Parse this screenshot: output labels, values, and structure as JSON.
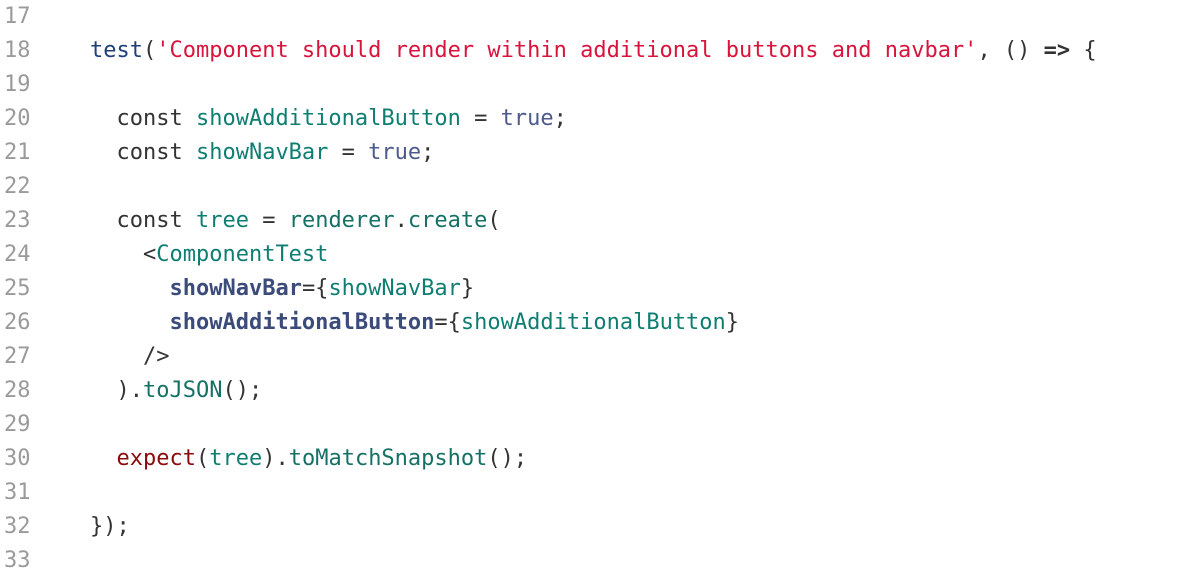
{
  "lines": [
    {
      "num": "17",
      "tokens": []
    },
    {
      "num": "18",
      "tokens": [
        {
          "t": "test",
          "c": "fn"
        },
        {
          "t": "(",
          "c": "plain"
        },
        {
          "t": "'Component should render within additional buttons and navbar'",
          "c": "str"
        },
        {
          "t": ", () ",
          "c": "plain"
        },
        {
          "t": "=>",
          "c": "bold"
        },
        {
          "t": " {",
          "c": "plain"
        }
      ]
    },
    {
      "num": "19",
      "tokens": []
    },
    {
      "num": "20",
      "tokens": [
        {
          "t": "  const ",
          "c": "plain"
        },
        {
          "t": "showAdditionalButton",
          "c": "var"
        },
        {
          "t": " = ",
          "c": "plain"
        },
        {
          "t": "true",
          "c": "bool"
        },
        {
          "t": ";",
          "c": "plain"
        }
      ]
    },
    {
      "num": "21",
      "tokens": [
        {
          "t": "  const ",
          "c": "plain"
        },
        {
          "t": "showNavBar",
          "c": "var"
        },
        {
          "t": " = ",
          "c": "plain"
        },
        {
          "t": "true",
          "c": "bool"
        },
        {
          "t": ";",
          "c": "plain"
        }
      ]
    },
    {
      "num": "22",
      "tokens": []
    },
    {
      "num": "23",
      "tokens": [
        {
          "t": "  const ",
          "c": "plain"
        },
        {
          "t": "tree",
          "c": "var"
        },
        {
          "t": " = ",
          "c": "plain"
        },
        {
          "t": "renderer",
          "c": "call"
        },
        {
          "t": ".",
          "c": "plain"
        },
        {
          "t": "create",
          "c": "call"
        },
        {
          "t": "(",
          "c": "plain"
        }
      ]
    },
    {
      "num": "24",
      "tokens": [
        {
          "t": "    <",
          "c": "plain"
        },
        {
          "t": "ComponentTest",
          "c": "var"
        }
      ]
    },
    {
      "num": "25",
      "tokens": [
        {
          "t": "      ",
          "c": "plain"
        },
        {
          "t": "showNavBar",
          "c": "attr"
        },
        {
          "t": "={",
          "c": "plain"
        },
        {
          "t": "showNavBar",
          "c": "var"
        },
        {
          "t": "}",
          "c": "plain"
        }
      ]
    },
    {
      "num": "26",
      "tokens": [
        {
          "t": "      ",
          "c": "plain"
        },
        {
          "t": "showAdditionalButton",
          "c": "attr"
        },
        {
          "t": "={",
          "c": "plain"
        },
        {
          "t": "showAdditionalButton",
          "c": "var"
        },
        {
          "t": "}",
          "c": "plain"
        }
      ]
    },
    {
      "num": "27",
      "tokens": [
        {
          "t": "    />",
          "c": "plain"
        }
      ]
    },
    {
      "num": "28",
      "tokens": [
        {
          "t": "  ).",
          "c": "plain"
        },
        {
          "t": "toJSON",
          "c": "call"
        },
        {
          "t": "();",
          "c": "plain"
        }
      ]
    },
    {
      "num": "29",
      "tokens": []
    },
    {
      "num": "30",
      "tokens": [
        {
          "t": "  ",
          "c": "plain"
        },
        {
          "t": "expect",
          "c": "expect"
        },
        {
          "t": "(",
          "c": "plain"
        },
        {
          "t": "tree",
          "c": "var"
        },
        {
          "t": ").",
          "c": "plain"
        },
        {
          "t": "toMatchSnapshot",
          "c": "call"
        },
        {
          "t": "();",
          "c": "plain"
        }
      ]
    },
    {
      "num": "31",
      "tokens": []
    },
    {
      "num": "32",
      "tokens": [
        {
          "t": "});",
          "c": "plain"
        }
      ]
    },
    {
      "num": "33",
      "tokens": []
    }
  ]
}
